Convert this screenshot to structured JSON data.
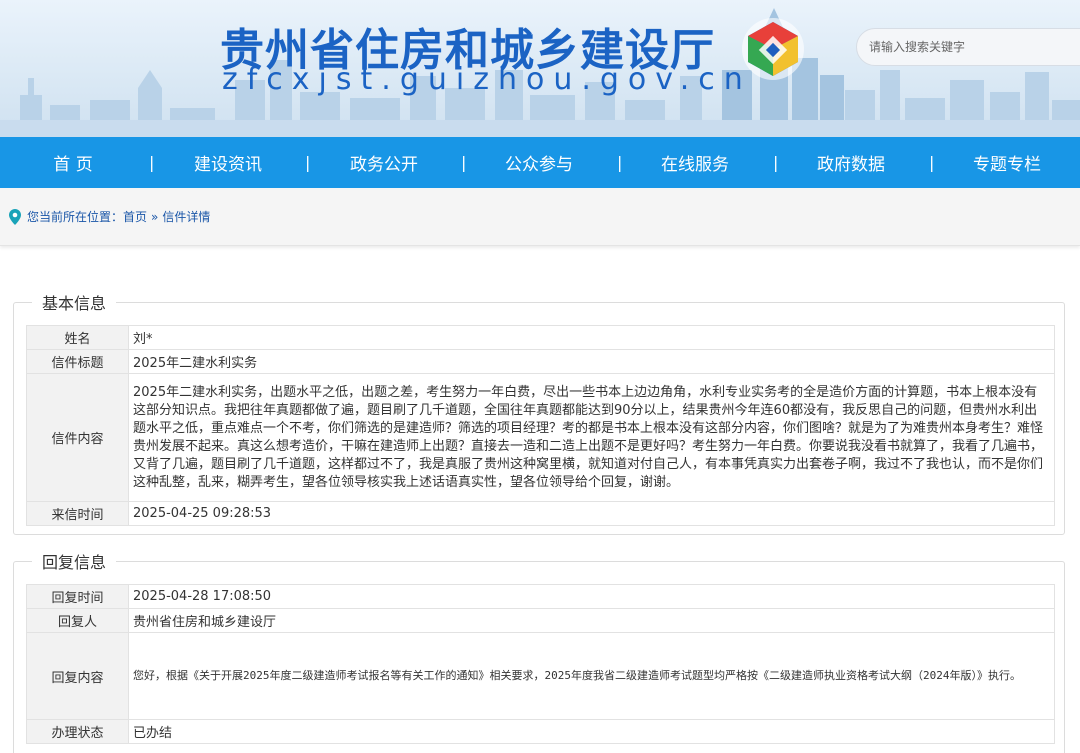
{
  "header": {
    "site_title": "贵州省住房和城乡建设厅",
    "site_url": "zfcxjst.guizhou.gov.cn",
    "search_placeholder": "请输入搜索关键字"
  },
  "nav": {
    "items": [
      "首 页",
      "建设资讯",
      "政务公开",
      "公众参与",
      "在线服务",
      "政府数据",
      "专题专栏"
    ],
    "separator": "|"
  },
  "breadcrumb": {
    "prefix": "您当前所在位置：",
    "home": "首页",
    "separator": "»",
    "current": "信件详情"
  },
  "basic_info": {
    "title": "基本信息",
    "name_label": "姓名",
    "name_value": "刘*",
    "subject_label": "信件标题",
    "subject_value": "2025年二建水利实务",
    "content_label": "信件内容",
    "content_value": "2025年二建水利实务，出题水平之低，出题之差，考生努力一年白费，尽出一些书本上边边角角，水利专业实务考的全是造价方面的计算题，书本上根本没有这部分知识点。我把往年真题都做了遍，题目刷了几千道题，全国往年真题都能达到90分以上，结果贵州今年连60都没有，我反思自己的问题，但贵州水利出题水平之低，重点难点一个不考，你们筛选的是建造师？筛选的项目经理？考的都是书本上根本没有这部分内容，你们图啥？就是为了为难贵州本身考生？难怪贵州发展不起来。真这么想考造价，干嘛在建造师上出题？直接去一造和二造上出题不是更好吗？考生努力一年白费。你要说我没看书就算了，我看了几遍书，又背了几遍，题目刷了几千道题，这样都过不了，我是真服了贵州这种窝里横，就知道对付自己人，有本事凭真实力出套卷子啊，我过不了我也认，而不是你们这种乱整，乱来，糊弄考生，望各位领导核实我上述话语真实性，望各位领导给个回复，谢谢。",
    "date_label": "来信时间",
    "date_value": "2025-04-25 09:28:53"
  },
  "reply_info": {
    "title": "回复信息",
    "time_label": "回复时间",
    "time_value": "2025-04-28 17:08:50",
    "replier_label": "回复人",
    "replier_value": "贵州省住房和城乡建设厅",
    "content_label": "回复内容",
    "content_value": "您好，根据《关于开展2025年度二级建造师考试报名等有关工作的通知》相关要求，2025年度我省二级建造师考试题型均严格按《二级建造师执业资格考试大纲（2024年版）》执行。",
    "status_label": "办理状态",
    "status_value": "已办结"
  },
  "colors": {
    "nav_bg": "#1896e6",
    "title_blue": "#1b63c4",
    "link_blue": "#1a56a8",
    "pin_teal": "#1aa3b8"
  },
  "icons": [
    "location-pin-icon",
    "emblem-logo"
  ]
}
